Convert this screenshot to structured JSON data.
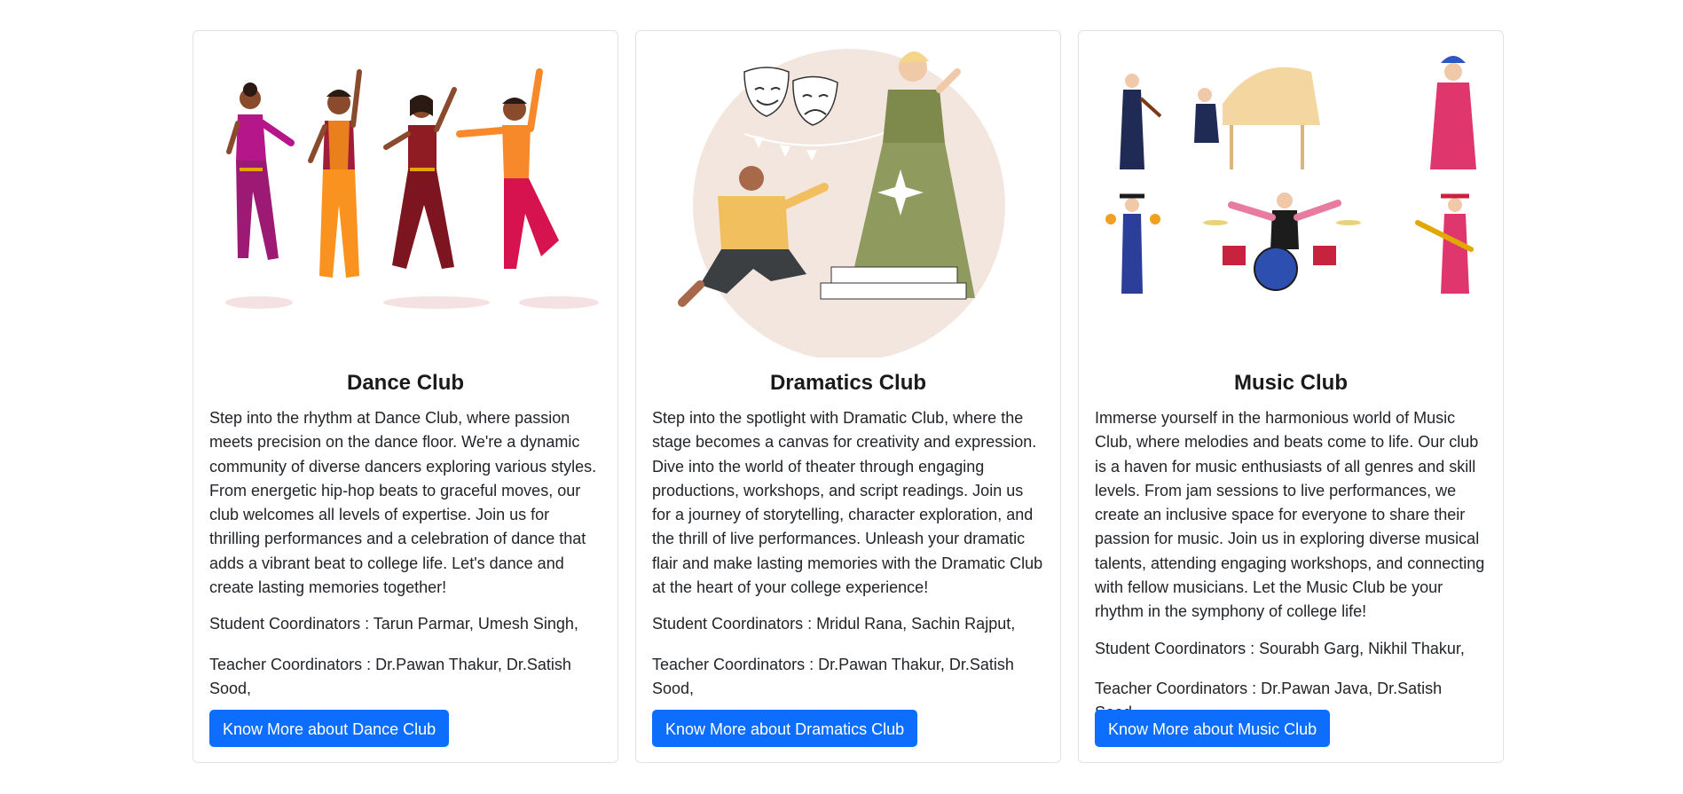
{
  "cards": [
    {
      "title": "Dance Club",
      "description": "Step into the rhythm at Dance Club, where passion meets precision on the dance floor. We're a dynamic community of diverse dancers exploring various styles. From energetic hip-hop beats to graceful moves, our club welcomes all levels of expertise. Join us for thrilling performances and a celebration of dance that adds a vibrant beat to college life. Let's dance and create lasting memories together!",
      "student_coordinators": "Student Coordinators : Tarun Parmar, Umesh Singh,",
      "teacher_coordinators": "Teacher Coordinators : Dr.Pawan Thakur, Dr.Satish Sood,",
      "button_label": "Know More about Dance Club",
      "image_icon": "dancers-illustration"
    },
    {
      "title": "Dramatics Club",
      "description": "Step into the spotlight with Dramatic Club, where the stage becomes a canvas for creativity and expression. Dive into the world of theater through engaging productions, workshops, and script readings. Join us for a journey of storytelling, character exploration, and the thrill of live performances. Unleash your dramatic flair and make lasting memories with the Dramatic Club at the heart of your college experience!",
      "student_coordinators": "Student Coordinators : Mridul Rana, Sachin Rajput,",
      "teacher_coordinators": "Teacher Coordinators : Dr.Pawan Thakur, Dr.Satish Sood,",
      "button_label": "Know More about Dramatics Club",
      "image_icon": "theater-masks-actors-illustration"
    },
    {
      "title": "Music Club",
      "description": "Immerse yourself in the harmonious world of Music Club, where melodies and beats come to life. Our club is a haven for music enthusiasts of all genres and skill levels. From jam sessions to live performances, we create an inclusive space for everyone to share their passion for music. Join us in exploring diverse musical talents, attending engaging workshops, and connecting with fellow musicians. Let the Music Club be your rhythm in the symphony of college life!",
      "student_coordinators": "Student Coordinators : Sourabh Garg, Nikhil Thakur,",
      "teacher_coordinators": "Teacher Coordinators : Dr.Pawan Java, Dr.Satish Sood,",
      "button_label": "Know More about Music Club",
      "image_icon": "musicians-illustration"
    }
  ],
  "colors": {
    "button": "#0d6efd",
    "border": "#dee2e6",
    "text": "#212529"
  }
}
